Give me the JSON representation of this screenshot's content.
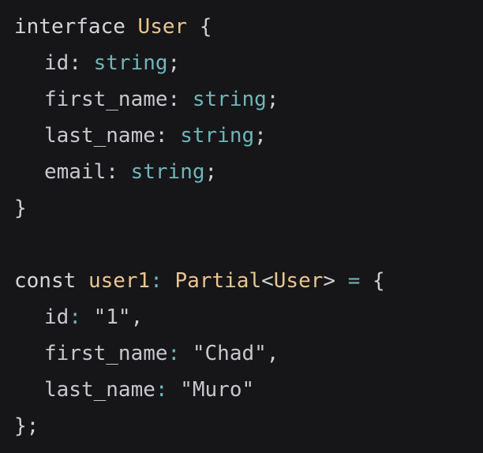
{
  "code": {
    "interface_keyword": "interface",
    "interface_name": "User",
    "open_brace": "{",
    "close_brace": "}",
    "fields": [
      {
        "name": "id",
        "colon": ":",
        "type": "string",
        "semi": ";"
      },
      {
        "name": "first_name",
        "colon": ":",
        "type": "string",
        "semi": ";"
      },
      {
        "name": "last_name",
        "colon": ":",
        "type": "string",
        "semi": ";"
      },
      {
        "name": "email",
        "colon": ":",
        "type": "string",
        "semi": ";"
      }
    ],
    "const_keyword": "const",
    "var_name": "user1",
    "var_colon": ":",
    "generic_name": "Partial",
    "generic_open": "<",
    "generic_arg": "User",
    "generic_close": ">",
    "equals": "=",
    "obj_open": "{",
    "values": [
      {
        "name": "id",
        "colon": ":",
        "value": "\"1\"",
        "comma": ","
      },
      {
        "name": "first_name",
        "colon": ":",
        "value": "\"Chad\"",
        "comma": ","
      },
      {
        "name": "last_name",
        "colon": ":",
        "value": "\"Muro\"",
        "comma": ""
      }
    ],
    "obj_close": "};"
  },
  "colors": {
    "background": "#161618",
    "keyword": "#d6d3d8",
    "type_name": "#e8c591",
    "primitive_type": "#6fb5b8",
    "property": "#c9c6ce"
  }
}
